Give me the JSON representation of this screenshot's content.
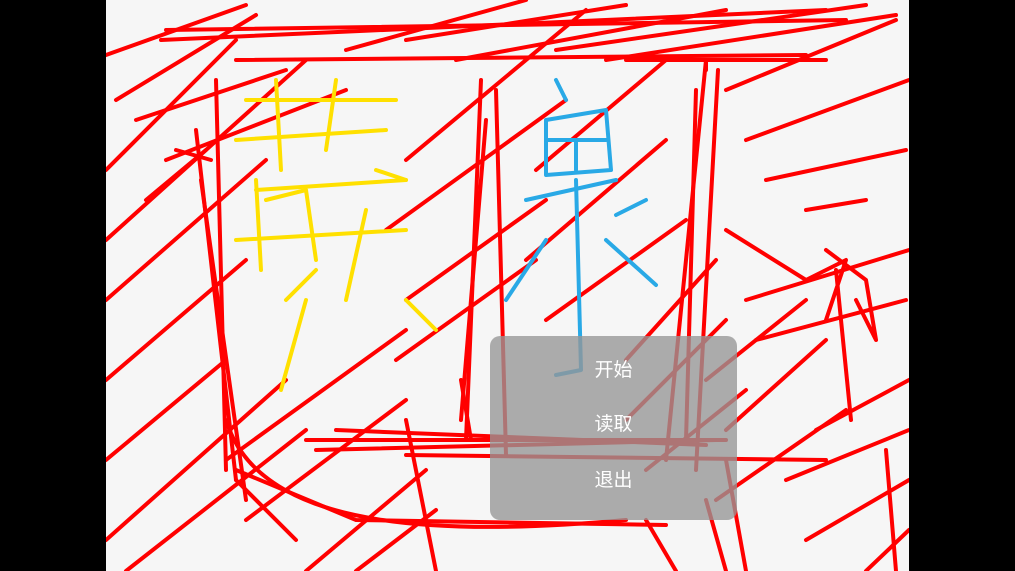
{
  "menu": {
    "items": [
      {
        "label": "开始"
      },
      {
        "label": "读取"
      },
      {
        "label": "退出"
      }
    ]
  },
  "colors": {
    "background": "#000000",
    "canvas": "#f6f6f6",
    "stroke_red": "#ff0000",
    "stroke_yellow": "#ffe000",
    "stroke_blue": "#29a9e6",
    "menu_panel": "#969696",
    "menu_text": "#ffffff"
  },
  "artwork": {
    "description_icons": [
      "red-scribble-strokes",
      "yellow-hand-drawn-glyph",
      "blue-hand-drawn-glyph"
    ]
  }
}
